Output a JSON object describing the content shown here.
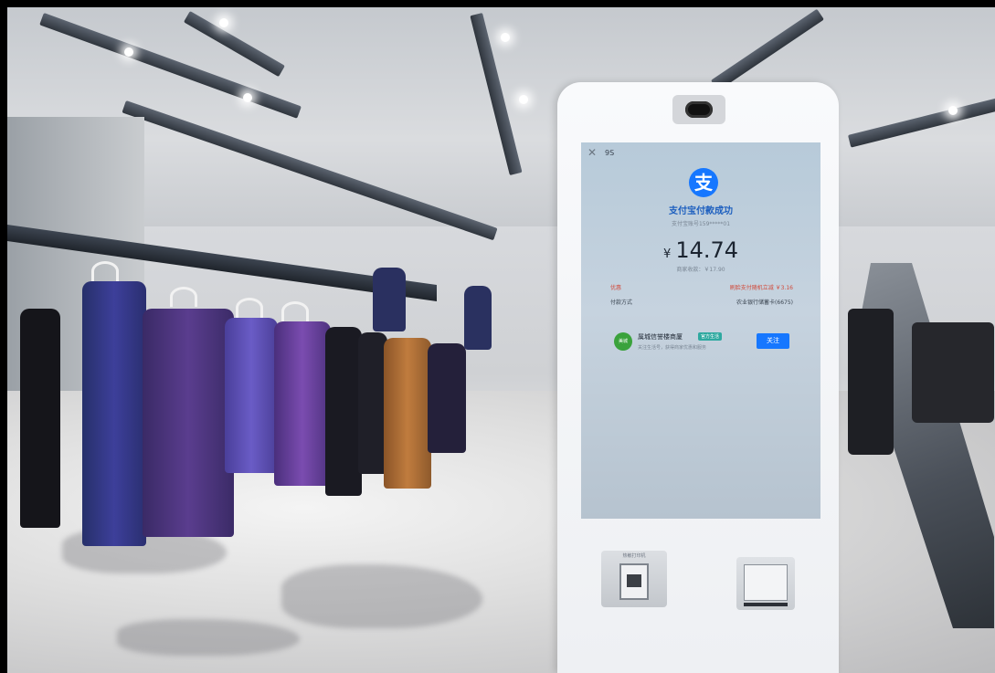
{
  "screen": {
    "close_icon": "close-icon",
    "countdown": "9S",
    "logo_glyph": "支",
    "title": "支付宝付款成功",
    "account": "支付宝账号159*****01",
    "currency": "¥",
    "amount": "14.74",
    "original_price": "商家收款：￥17.90",
    "discount_label": "优惠",
    "discount_value": "刷脸支付随机立减 ￥3.16",
    "method_label": "付款方式",
    "method_value": "农业银行储蓄卡(6675)",
    "merchant": {
      "icon_text": "美城",
      "name": "属城信誉楼商厦",
      "tag": "官方生活",
      "desc": "关注生活号，获得商家优惠和服务",
      "follow_label": "关注"
    }
  },
  "hardware": {
    "printer_label": "热敏打印机"
  },
  "colors": {
    "alipay_blue": "#1677ff",
    "discount_red": "#d24a3a",
    "merchant_green": "#3aa23c"
  }
}
